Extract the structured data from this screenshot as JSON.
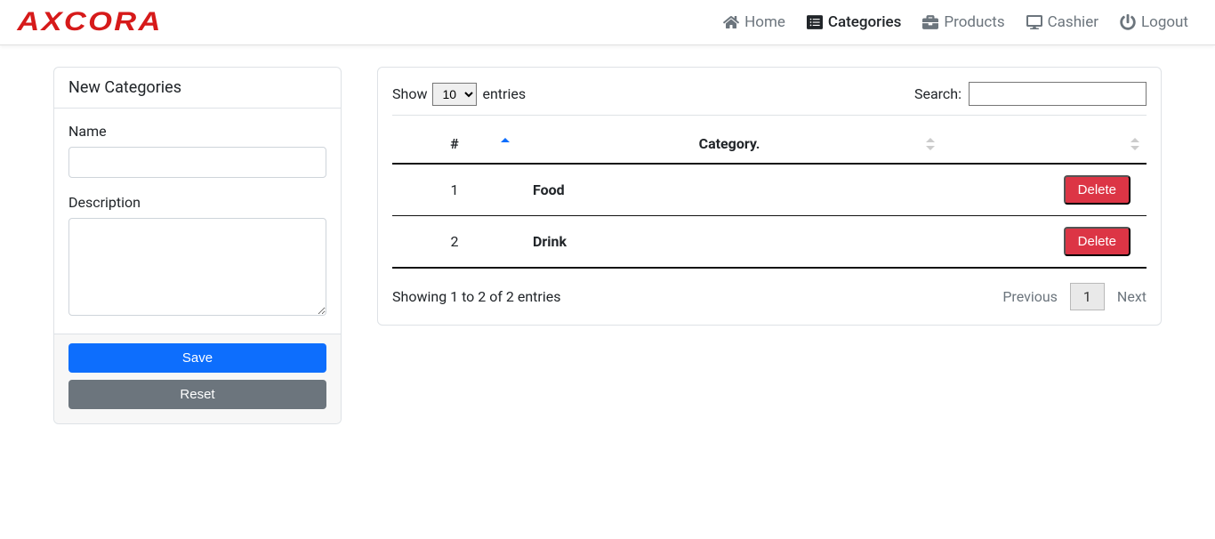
{
  "logo_text": "AXCORA",
  "nav": {
    "home": "Home",
    "categories": "Categories",
    "products": "Products",
    "cashier": "Cashier",
    "logout": "Logout"
  },
  "form": {
    "header": "New Categories",
    "name_label": "Name",
    "name_value": "",
    "description_label": "Description",
    "description_value": "",
    "save_label": "Save",
    "reset_label": "Reset"
  },
  "datatable": {
    "length_prefix": "Show",
    "length_suffix": "entries",
    "length_value": "10",
    "search_label": "Search:",
    "search_value": "",
    "columns": {
      "num": "#",
      "category": "Category.",
      "action": ""
    },
    "rows": [
      {
        "num": "1",
        "category": "Food",
        "action": "Delete"
      },
      {
        "num": "2",
        "category": "Drink",
        "action": "Delete"
      }
    ],
    "info": "Showing 1 to 2 of 2 entries",
    "previous": "Previous",
    "next": "Next",
    "current_page": "1"
  }
}
